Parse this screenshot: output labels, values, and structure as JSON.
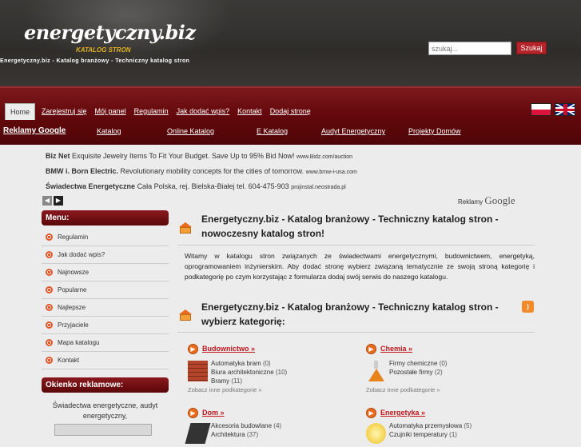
{
  "header": {
    "logo": "energetyczny.biz",
    "logo_sub": "KATALOG STRON",
    "tagline": "Energetyczny.biz - Katalog branżowy - Techniczny katalog stron",
    "search_placeholder": "szukaj...",
    "search_button": "Szukaj"
  },
  "nav": {
    "items": [
      "Home",
      "Zarejestruj się",
      "Mój panel",
      "Regulamin",
      "Jak dodać wpis?",
      "Kontakt",
      "Dodaj stronę"
    ],
    "flags": [
      "flag-pl-icon",
      "flag-gb-icon"
    ]
  },
  "nav2": {
    "google": "Reklamy Google",
    "links": [
      "Katalog",
      "Online Katalog",
      "E Katalog",
      "Audyt Energetyczny",
      "Projekty Domów"
    ]
  },
  "ads": [
    {
      "title": "Biz Net",
      "text": "Exquisite Jewelry Items To Fit Your Budget. Save Up to 95% Bid Now!",
      "url": "www.Bidz.com/auction"
    },
    {
      "title": "BMW i. Born Electric.",
      "text": "Revolutionary mobility concepts for the cities of tomorrow.",
      "url": "www.bmw-i-usa.com"
    },
    {
      "title": "Świadectwa Energetyczne",
      "text": "Cała Polska, rej. Bielska-Białej tel. 604-475-903",
      "url": "projinstal.neostrada.pl"
    }
  ],
  "ads_label": "Reklamy",
  "ads_brand": "Google",
  "sidebar": {
    "menu_title": "Menu:",
    "items": [
      "Regulamin",
      "Jak dodać wpis?",
      "Najnowsze",
      "Popularne",
      "Najlepsze",
      "Przyjaciele",
      "Mapa katalogu",
      "Kontakt"
    ],
    "ad_title": "Okienko reklamowe:",
    "ad_text": "Świadectwa energetyczne, audyt energetyczny,"
  },
  "main": {
    "intro_title": "Energetyczny.biz - Katalog branżowy - Techniczny katalog stron - nowoczesny katalog stron!",
    "intro_text": "Witamy w katalogu stron związanych ze świadectwami energetycznymi, budownictwem, energetyką, oprogramowaniem inżynierskim. Aby dodać stronę wybierz związaną tematycznie ze swoją stroną kategorię i podkategorię po czym korzystając z formularza dodaj swój serwis do naszego katalogu.",
    "cat_title": "Energetyczny.biz - Katalog branżowy - Techniczny katalog stron - wybierz kategorię:",
    "more": "Zobacz inne podkategorie »",
    "categories": [
      {
        "name": "Budownictwo »",
        "subs": [
          {
            "n": "Automatyka bram",
            "c": "(0)"
          },
          {
            "n": "Biura architektoniczne",
            "c": "(10)"
          },
          {
            "n": "Bramy",
            "c": "(11)"
          }
        ]
      },
      {
        "name": "Chemia »",
        "subs": [
          {
            "n": "Firmy chemiczne",
            "c": "(0)"
          },
          {
            "n": "Pozostałe firmy",
            "c": "(2)"
          }
        ]
      },
      {
        "name": "Dom »",
        "subs": [
          {
            "n": "Akcesoria budowlane",
            "c": "(4)"
          },
          {
            "n": "Architektura",
            "c": "(37)"
          }
        ]
      },
      {
        "name": "Energetyka »",
        "subs": [
          {
            "n": "Automatyka przemysłowa",
            "c": "(5)"
          },
          {
            "n": "Czujniki temperatury",
            "c": "(1)"
          }
        ]
      }
    ]
  }
}
